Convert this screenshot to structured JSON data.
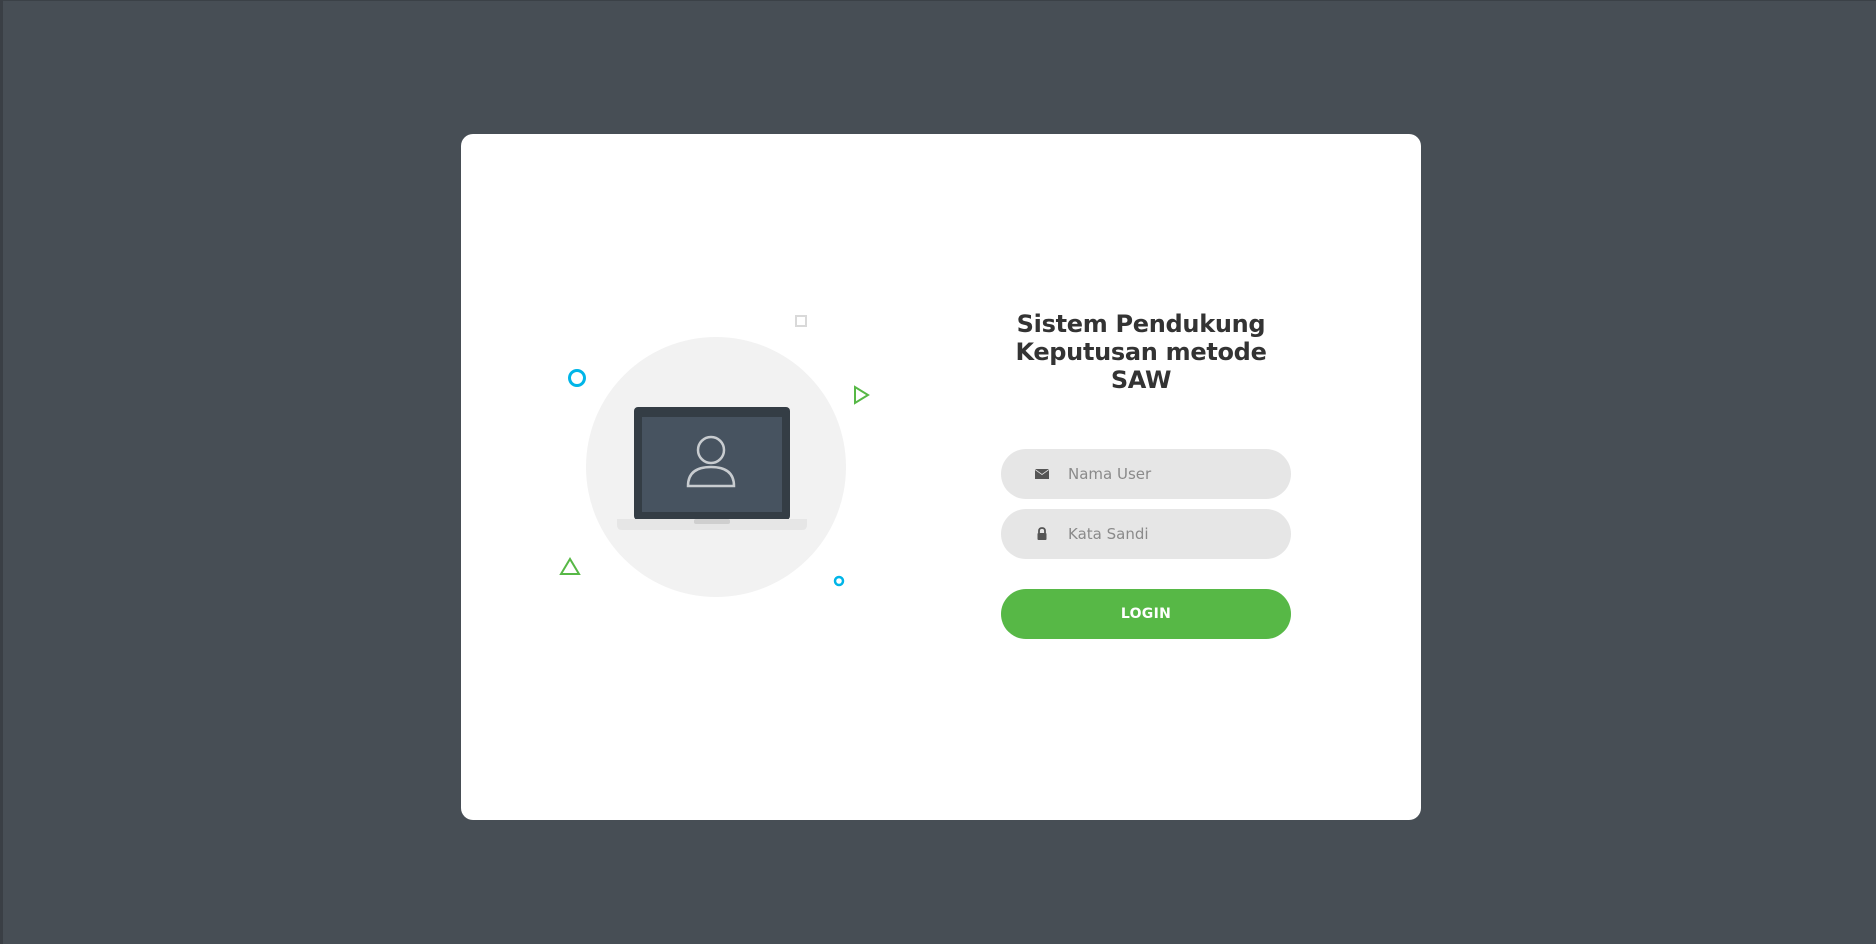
{
  "login": {
    "title_line1": "Sistem Pendukung",
    "title_line2": "Keputusan metode",
    "title_line3": "SAW",
    "username": {
      "value": "",
      "placeholder": "Nama User",
      "icon": "envelope-icon"
    },
    "password": {
      "value": "",
      "placeholder": "Kata Sandi",
      "icon": "lock-icon"
    },
    "login_label": "LOGIN"
  },
  "illustration": {
    "icon": "laptop-user-icon",
    "decorations": [
      "circle-outline-blue",
      "square-outline-gray",
      "triangle-outline-green",
      "triangle-outline-green",
      "circle-outline-blue-small"
    ]
  },
  "colors": {
    "page_background": "#474e55",
    "card_background": "#ffffff",
    "accent_green": "#57b846",
    "accent_blue": "#00b5e8",
    "input_background": "#e6e6e6",
    "title_text": "#333333"
  }
}
